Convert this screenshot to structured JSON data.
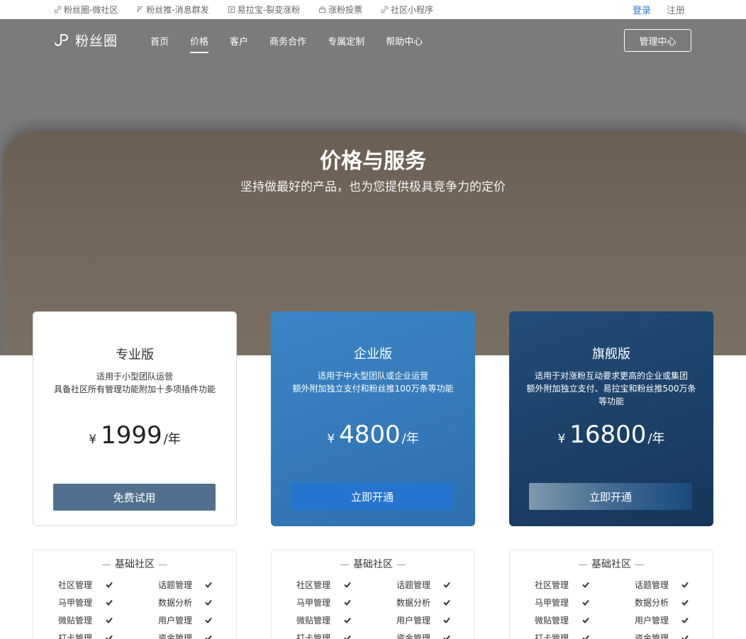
{
  "topbar": {
    "links": [
      {
        "label": "粉丝圈-微社区",
        "icon": "link-icon"
      },
      {
        "label": "粉丝推-消息群发",
        "icon": "push-icon"
      },
      {
        "label": "易拉宝-裂变涨粉",
        "icon": "banner-icon"
      },
      {
        "label": "涨粉投票",
        "icon": "vote-icon"
      },
      {
        "label": "社区小程序",
        "icon": "link-icon"
      }
    ],
    "login": "登录",
    "register": "注册"
  },
  "nav": {
    "logo_text": "粉丝圈",
    "items": [
      "首页",
      "价格",
      "客户",
      "商务合作",
      "专属定制",
      "帮助中心"
    ],
    "active_index": 1,
    "admin_button": "管理中心"
  },
  "hero": {
    "title": "价格与服务",
    "subtitle": "坚持做最好的产品，也为您提供极具竞争力的定价"
  },
  "plans": [
    {
      "name": "专业版",
      "desc1": "适用于小型团队运营",
      "desc2": "具备社区所有管理功能附加十多项插件功能",
      "currency": "¥",
      "price": "1999",
      "unit": "/年",
      "cta": "免费试用"
    },
    {
      "name": "企业版",
      "desc1": "适用于中大型团队或企业运营",
      "desc2": "额外附加独立支付和粉丝推100万条等功能",
      "currency": "¥",
      "price": "4800",
      "unit": "/年",
      "cta": "立即开通"
    },
    {
      "name": "旗舰版",
      "desc1": "适用于对涨粉互动要求更高的企业或集团",
      "desc2": "额外附加独立支付、易拉宝和粉丝推500万条等功能",
      "currency": "¥",
      "price": "16800",
      "unit": "/年",
      "cta": "立即开通"
    }
  ],
  "features": {
    "title": "基础社区",
    "rows": [
      [
        "社区管理",
        "话题管理"
      ],
      [
        "马甲管理",
        "数据分析"
      ],
      [
        "微贴管理",
        "用户管理"
      ],
      [
        "打卡管理",
        "资金管理"
      ]
    ]
  },
  "colors": {
    "accent": "#2a7bd3",
    "plan_pro_button": "#51708f",
    "plan_enterprise": "#3a86c6",
    "plan_flagship": "#1d4068"
  }
}
